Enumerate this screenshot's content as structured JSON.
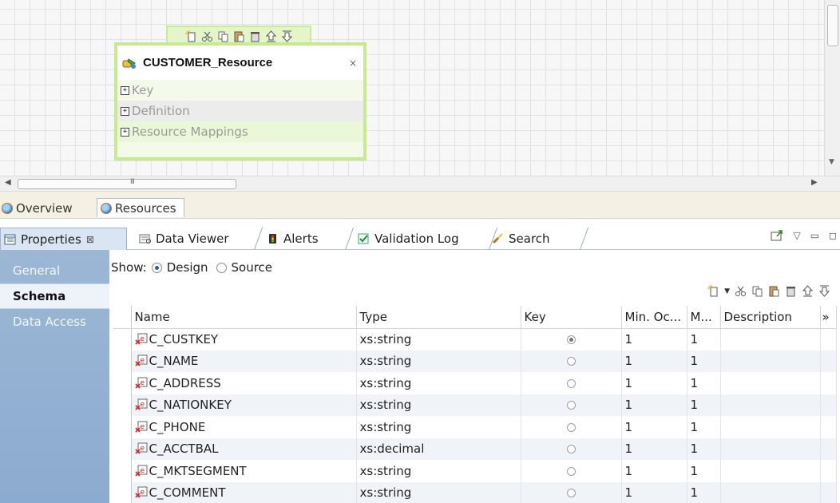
{
  "node": {
    "title": "CUSTOMER_Resource",
    "close": "×",
    "rows": [
      "Key",
      "Definition",
      "Resource Mappings"
    ],
    "toolbar_icons": [
      "new-icon",
      "cut-icon",
      "copy-icon",
      "paste-icon",
      "delete-icon",
      "move-up-icon",
      "move-down-icon"
    ]
  },
  "scroll": {
    "grip": "III"
  },
  "editor_tabs": [
    "Overview",
    "Resources"
  ],
  "properties_tabs": [
    {
      "label": "Properties",
      "close": "⊠"
    },
    {
      "label": "Data Viewer"
    },
    {
      "label": "Alerts"
    },
    {
      "label": "Validation Log"
    },
    {
      "label": "Search"
    }
  ],
  "side_tabs": [
    "General",
    "Schema",
    "Data Access"
  ],
  "show": {
    "label": "Show:",
    "design": "Design",
    "source": "Source",
    "selected": "Design"
  },
  "columns": [
    "Name",
    "Type",
    "Key",
    "Min. Oc...",
    "M...",
    "Description",
    "»"
  ],
  "rows": [
    {
      "name": "C_CUSTKEY",
      "type": "xs:string",
      "key": true,
      "min": "1",
      "max": "1",
      "desc": ""
    },
    {
      "name": "C_NAME",
      "type": "xs:string",
      "key": false,
      "min": "1",
      "max": "1",
      "desc": ""
    },
    {
      "name": "C_ADDRESS",
      "type": "xs:string",
      "key": false,
      "min": "1",
      "max": "1",
      "desc": ""
    },
    {
      "name": "C_NATIONKEY",
      "type": "xs:string",
      "key": false,
      "min": "1",
      "max": "1",
      "desc": ""
    },
    {
      "name": "C_PHONE",
      "type": "xs:string",
      "key": false,
      "min": "1",
      "max": "1",
      "desc": ""
    },
    {
      "name": "C_ACCTBAL",
      "type": "xs:decimal",
      "key": false,
      "min": "1",
      "max": "1",
      "desc": ""
    },
    {
      "name": "C_MKTSEGMENT",
      "type": "xs:string",
      "key": false,
      "min": "1",
      "max": "1",
      "desc": ""
    },
    {
      "name": "C_COMMENT",
      "type": "xs:string",
      "key": false,
      "min": "1",
      "max": "1",
      "desc": ""
    }
  ],
  "colors": {
    "node_border": "#c7ea91",
    "side_tabs": "#8cabd0",
    "active_tab": "#d9e5f3"
  }
}
